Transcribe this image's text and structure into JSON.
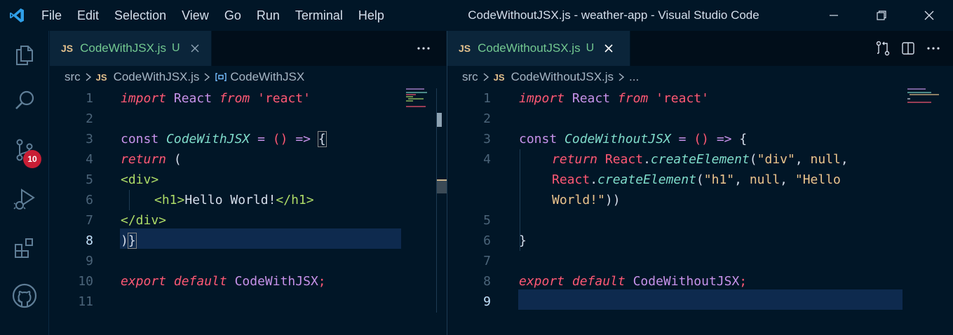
{
  "window": {
    "title": "CodeWithoutJSX.js - weather-app - Visual Studio Code",
    "menu": [
      "File",
      "Edit",
      "Selection",
      "View",
      "Go",
      "Run",
      "Terminal",
      "Help"
    ]
  },
  "activity_bar": {
    "items": [
      {
        "name": "explorer-icon"
      },
      {
        "name": "search-icon"
      },
      {
        "name": "source-control-icon",
        "badge": "10"
      },
      {
        "name": "run-debug-icon"
      },
      {
        "name": "extensions-icon"
      },
      {
        "name": "github-icon"
      }
    ]
  },
  "left_editor": {
    "tab": {
      "lang": "JS",
      "name": "CodeWithJSX.js",
      "status": "U"
    },
    "breadcrumb": {
      "folder": "src",
      "file_lang": "JS",
      "file": "CodeWithJSX.js",
      "symbol": "CodeWithJSX"
    },
    "line_numbers": [
      "1",
      "2",
      "3",
      "4",
      "5",
      "6",
      "7",
      "8",
      "9",
      "10",
      "11"
    ],
    "active_line": "8"
  },
  "right_editor": {
    "tab": {
      "lang": "JS",
      "name": "CodeWithoutJSX.js",
      "status": "U"
    },
    "breadcrumb": {
      "folder": "src",
      "file_lang": "JS",
      "file": "CodeWithoutJSX.js",
      "symbol": "..."
    },
    "line_numbers": [
      "1",
      "2",
      "3",
      "4",
      "",
      "",
      "5",
      "6",
      "7",
      "8",
      "9"
    ],
    "active_line": "9"
  },
  "code_text": {
    "l_import": "import",
    "l_react": "React",
    "l_from": "from",
    "l_str_react": "'react'",
    "l_const": "const",
    "l_name": "CodeWithJSX",
    "l_eq": "=",
    "l_parens": "()",
    "l_arrow": "=>",
    "l_brace": "{",
    "l_return": "return",
    "l_paren_open": "(",
    "l_div_open": "<div>",
    "l_h1_open": "<h1>",
    "l_hello": "Hello World!",
    "l_h1_close": "</h1>",
    "l_div_close": "</div>",
    "l_paren_close": ")",
    "l_brace_close": "}",
    "l_export": "export",
    "l_default": "default",
    "l_export_name": "CodeWithJSX",
    "l_semi": ";",
    "r_name": "CodeWithoutJSX",
    "r_create": "createElement",
    "r_div": "\"div\"",
    "r_null": "null",
    "r_h1": "\"h1\"",
    "r_hello1": "\"Hello",
    "r_hello2": "World!\"",
    "r_close": "))",
    "r_brace_close": "}",
    "r_export_name": "CodeWithoutJSX",
    "r_dot": ".",
    "r_comma": ",",
    "r_open": "(",
    "r_react": "React"
  }
}
